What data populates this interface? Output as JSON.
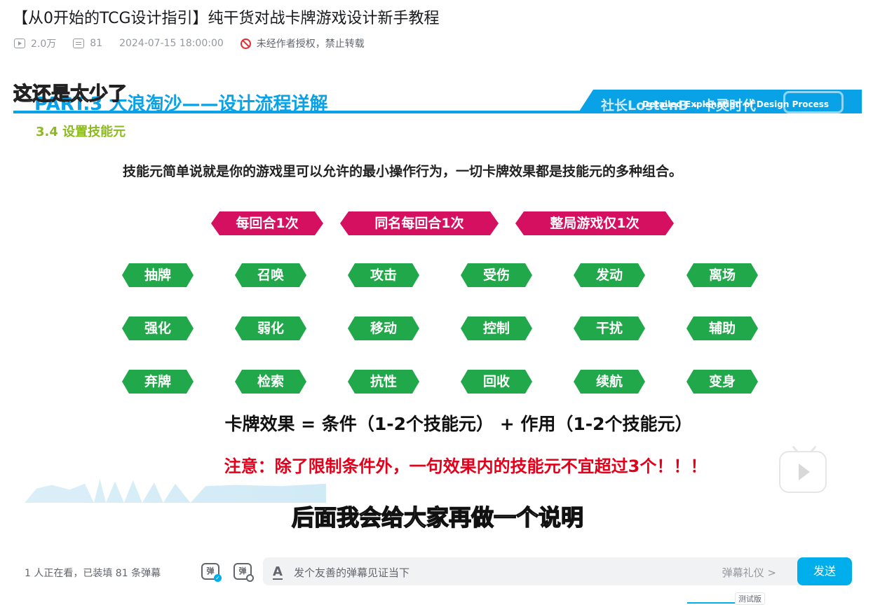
{
  "video": {
    "title": "【从0开始的TCG设计指引】纯干货对战卡牌游戏设计新手教程",
    "views": "2.0万",
    "danmaku_count": "81",
    "publish_time": "2024-07-15 18:00:00",
    "copyright_notice": "未经作者授权，禁止转载"
  },
  "slide": {
    "overlay_subtitle": "这还是太少了",
    "part_title": "PART.3 大浪淘沙——设计流程详解",
    "brand_text": "社长LostenB · 卡灵时代",
    "english_title": "Detailed Explanation of Design Process",
    "section": "3.4 设置技能元",
    "description": "技能元简单说就是你的游戏里可以允许的最小操作行为，一切卡牌效果都是技能元的多种组合。",
    "limit_tags": [
      "每回合1次",
      "同名每回合1次",
      "整局游戏仅1次"
    ],
    "skill_rows": [
      [
        "抽牌",
        "召唤",
        "攻击",
        "受伤",
        "发动",
        "离场"
      ],
      [
        "强化",
        "弱化",
        "移动",
        "控制",
        "干扰",
        "辅助"
      ],
      [
        "弃牌",
        "检索",
        "抗性",
        "回收",
        "续航",
        "变身"
      ]
    ],
    "formula": "卡牌效果 = 条件（1-2个技能元） + 作用（1-2个技能元）",
    "note": "注意：除了限制条件外，一句效果内的技能元不宜超过3个！！！",
    "caption": "后面我会给大家再做一个说明"
  },
  "controls": {
    "viewers": "1 人正在看，已装填 81 条弹幕",
    "danmaku_toggle_label": "弹",
    "danmaku_settings_label": "弹",
    "input_placeholder": "发个友善的弹幕见证当下",
    "etiquette_link": "弹幕礼仪 >",
    "send_label": "发送"
  },
  "footer": {
    "test_badge": "测试版"
  },
  "colors": {
    "accent_blue": "#0aa2e6",
    "skill_green": "#21a84a",
    "limit_pink": "#d61060",
    "note_red": "#e3001b",
    "send_blue": "#00aeec"
  }
}
